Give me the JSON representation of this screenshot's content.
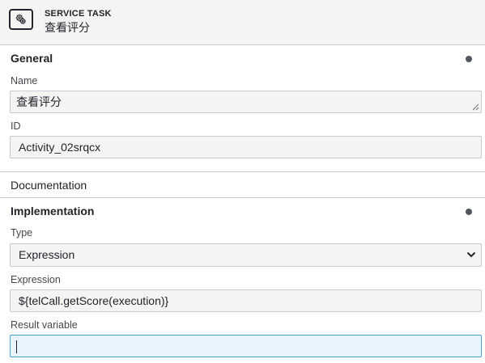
{
  "header": {
    "type_label": "SERVICE TASK",
    "element_name": "查看评分",
    "icon": "gear-icon"
  },
  "sections": {
    "general": {
      "title": "General",
      "name_label": "Name",
      "name_value": "查看评分",
      "id_label": "ID",
      "id_value": "Activity_02srqcx"
    },
    "documentation": {
      "title": "Documentation"
    },
    "implementation": {
      "title": "Implementation",
      "type_label": "Type",
      "type_value": "Expression",
      "expression_label": "Expression",
      "expression_value": "${telCall.getScore(execution)}",
      "result_variable_label": "Result variable",
      "result_variable_value": ""
    }
  },
  "colors": {
    "header_bg": "#f4f4f5",
    "field_bg": "#f4f4f5",
    "focus_bg": "#e8f4fd",
    "focus_border": "#4aa3df",
    "dot": "#52565e"
  }
}
